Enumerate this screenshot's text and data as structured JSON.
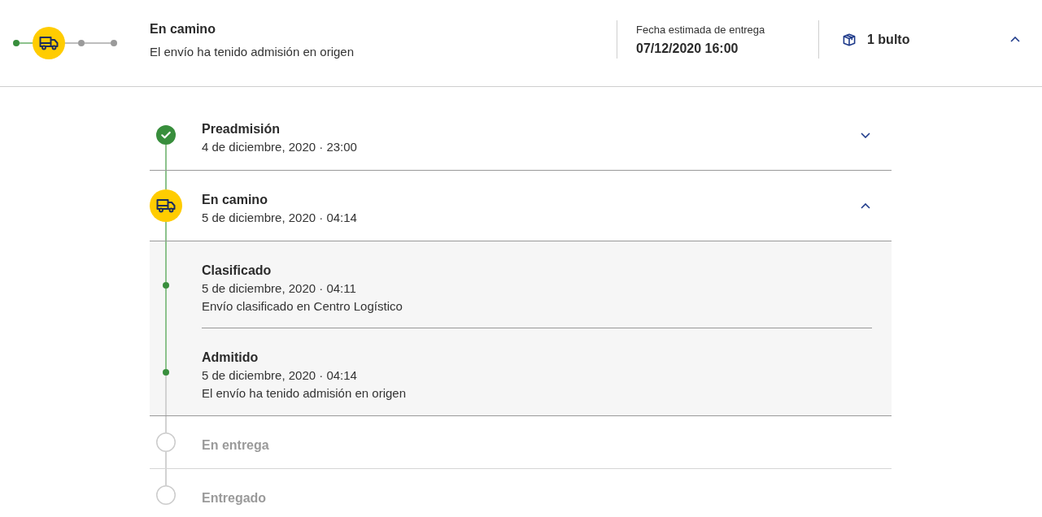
{
  "header": {
    "stepper": [
      {
        "kind": "done"
      },
      {
        "kind": "current"
      },
      {
        "kind": "pending"
      },
      {
        "kind": "pending"
      }
    ],
    "title": "En camino",
    "subtitle": "El envío ha tenido admisión en origen",
    "estimate": {
      "label": "Fecha estimada de entrega",
      "value": "07/12/2020 16:00"
    },
    "packages": "1 bulto",
    "expanded": true
  },
  "timeline": [
    {
      "kind": "done",
      "title": "Preadmisión",
      "date": "4 de diciembre, 2020 · 23:00",
      "expanded": false
    },
    {
      "kind": "current",
      "title": "En camino",
      "date": "5 de diciembre, 2020 · 04:14",
      "expanded": true,
      "events": [
        {
          "title": "Clasificado",
          "date": "5 de diciembre, 2020 · 04:11",
          "description": "Envío clasificado en Centro Logístico"
        },
        {
          "title": "Admitido",
          "date": "5 de diciembre, 2020 · 04:14",
          "description": "El envío ha tenido admisión en origen"
        }
      ]
    },
    {
      "kind": "pending",
      "title": "En entrega"
    },
    {
      "kind": "pending",
      "title": "Entregado"
    }
  ]
}
